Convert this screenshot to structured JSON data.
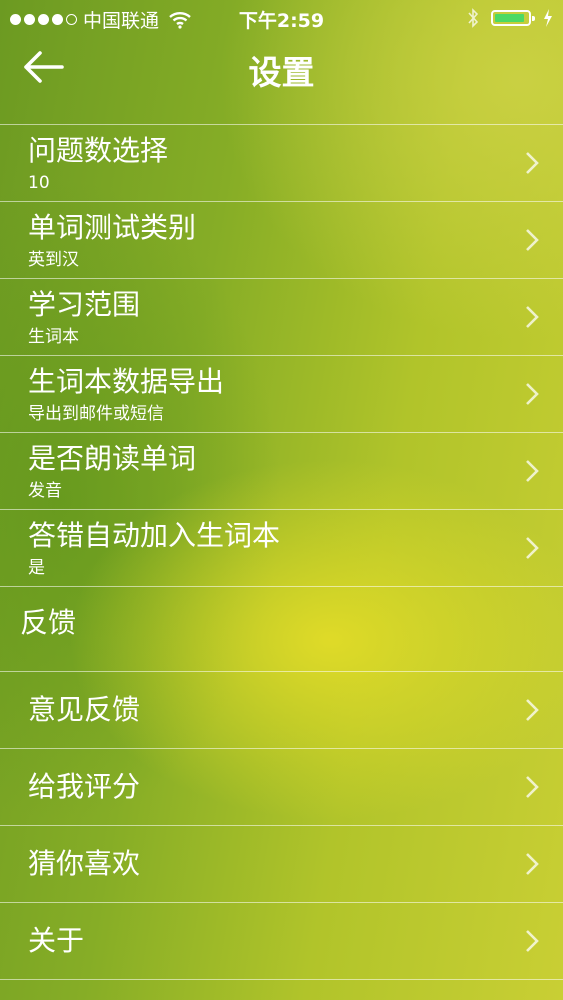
{
  "status_bar": {
    "carrier": "中国联通",
    "time": "下午2:59",
    "battery_color": "#4cd964",
    "battery_level": 0.9,
    "signal_bars": 4,
    "signal_total": 5
  },
  "navbar": {
    "back_icon": "arrow-left-icon",
    "title": "设置"
  },
  "settings": [
    {
      "title": "问题数选择",
      "subtitle": "10"
    },
    {
      "title": "单词测试类别",
      "subtitle": "英到汉"
    },
    {
      "title": "学习范围",
      "subtitle": "生词本"
    },
    {
      "title": "生词本数据导出",
      "subtitle": "导出到邮件或短信"
    },
    {
      "title": "是否朗读单词",
      "subtitle": "发音"
    },
    {
      "title": "答错自动加入生词本",
      "subtitle": "是"
    }
  ],
  "feedback_section": {
    "header": "反馈",
    "items": [
      {
        "title": "意见反馈"
      },
      {
        "title": "给我评分"
      },
      {
        "title": "猜你喜欢"
      },
      {
        "title": "关于"
      }
    ]
  }
}
